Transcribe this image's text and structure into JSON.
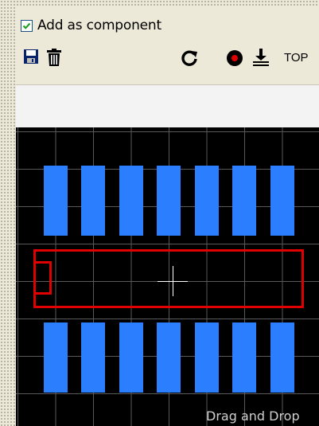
{
  "options": {
    "add_as_component_label": "Add as component",
    "add_as_component_checked": true
  },
  "toolbar": {
    "items": [
      "save-icon",
      "trash-icon",
      "rotate-icon",
      "record-dot-icon",
      "place-on-side-icon"
    ],
    "side_label": "TOP"
  },
  "canvas": {
    "hint": "Drag and Drop",
    "colors": {
      "background": "#000000",
      "grid": "#5a5a5a",
      "pad": "#2b7fff",
      "outline": "#e00000",
      "crosshair": "#ffffff"
    },
    "pads_per_row": 7,
    "pad_rows": 2
  }
}
